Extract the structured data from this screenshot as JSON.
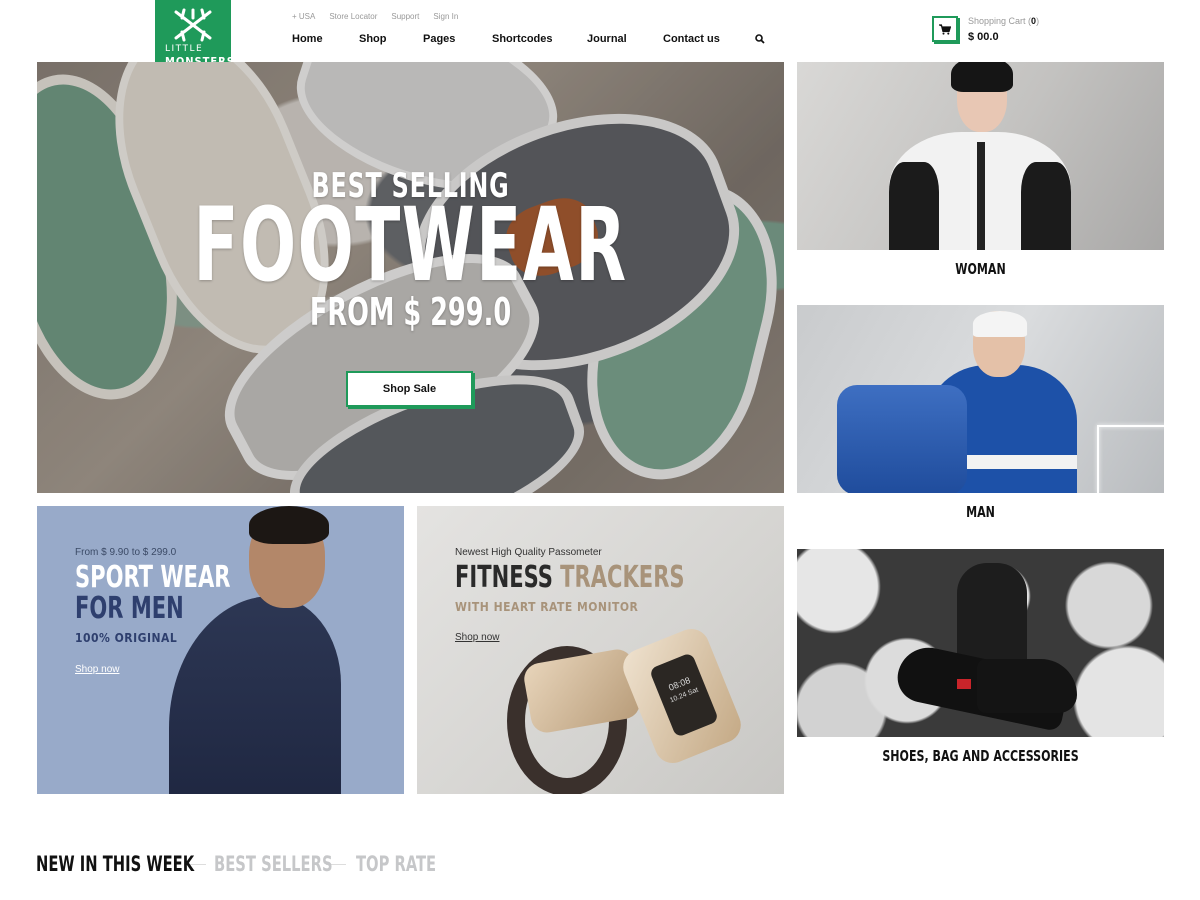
{
  "header": {
    "logo": {
      "line1": "LITTLE",
      "line2": "MONSTERS"
    },
    "top_links": [
      "+ USA",
      "Store Locator",
      "Support",
      "Sign In"
    ],
    "nav": [
      "Home",
      "Shop",
      "Pages",
      "Shortcodes",
      "Journal",
      "Contact us"
    ],
    "cart": {
      "label": "Shopping Cart (",
      "count": "0",
      "label_end": ")",
      "total": "$ 00.0"
    },
    "accent_color": "#1f9a5a"
  },
  "hero": {
    "pre_title": "BEST SELLING",
    "title": "FOOTWEAR",
    "price_line": "FROM $ 299.0",
    "button": "Shop Sale"
  },
  "categories": [
    {
      "caption": "WOMAN"
    },
    {
      "caption": "MAN"
    },
    {
      "caption": "SHOES, BAG AND ACCESSORIES"
    }
  ],
  "promo_men": {
    "price_range": "From $ 9.90 to $ 299.0",
    "title_line1": "SPORT WEAR",
    "title_line2": "FOR MEN",
    "subtitle": "100% ORIGINAL",
    "link": "Shop now",
    "background": "#98aac9"
  },
  "promo_fitness": {
    "eyebrow": "Newest High Quality Passometer",
    "title_dark": "FITNESS",
    "title_accent": "TRACKERS",
    "subtitle": "WITH HEART RATE MONITOR",
    "link": "Shop now",
    "screen_text": "08:08",
    "screen_date": "10.24 Sat"
  },
  "product_tabs": [
    "NEW IN THIS WEEK",
    "BEST SELLERS",
    "TOP RATE"
  ]
}
